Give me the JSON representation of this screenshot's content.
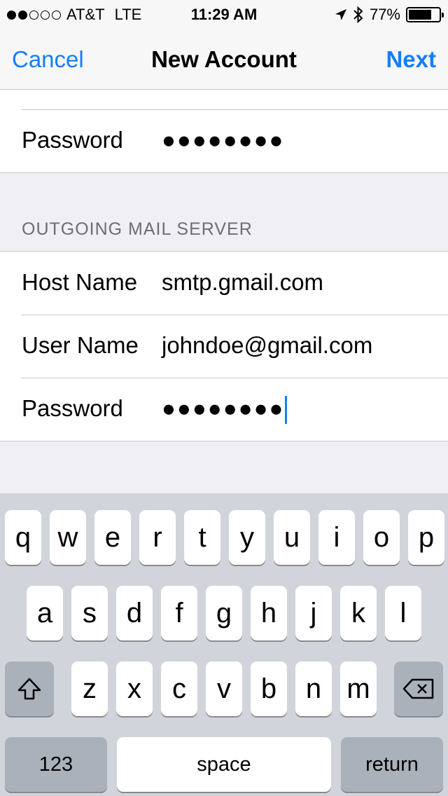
{
  "status_bar": {
    "carrier": "AT&T",
    "network": "LTE",
    "time": "11:29 AM",
    "battery_percent": "77%",
    "battery_level": 0.77,
    "signal_bars_filled": 2,
    "signal_bars_total": 5
  },
  "nav": {
    "left_button": "Cancel",
    "title": "New Account",
    "right_button": "Next"
  },
  "incoming": {
    "password_label": "Password",
    "password_value": "●●●●●●●●"
  },
  "outgoing": {
    "section_header": "OUTGOING MAIL SERVER",
    "host_label": "Host Name",
    "host_value": "smtp.gmail.com",
    "user_label": "User Name",
    "user_value": "johndoe@gmail.com",
    "password_label": "Password",
    "password_value": "●●●●●●●●"
  },
  "keyboard": {
    "row1": [
      "q",
      "w",
      "e",
      "r",
      "t",
      "y",
      "u",
      "i",
      "o",
      "p"
    ],
    "row2": [
      "a",
      "s",
      "d",
      "f",
      "g",
      "h",
      "j",
      "k",
      "l"
    ],
    "row3": [
      "z",
      "x",
      "c",
      "v",
      "b",
      "n",
      "m"
    ],
    "numbers_label": "123",
    "space_label": "space",
    "return_label": "return"
  },
  "colors": {
    "accent": "#147efb",
    "background": "#efeff4",
    "keyboard_bg": "#d1d5db"
  }
}
